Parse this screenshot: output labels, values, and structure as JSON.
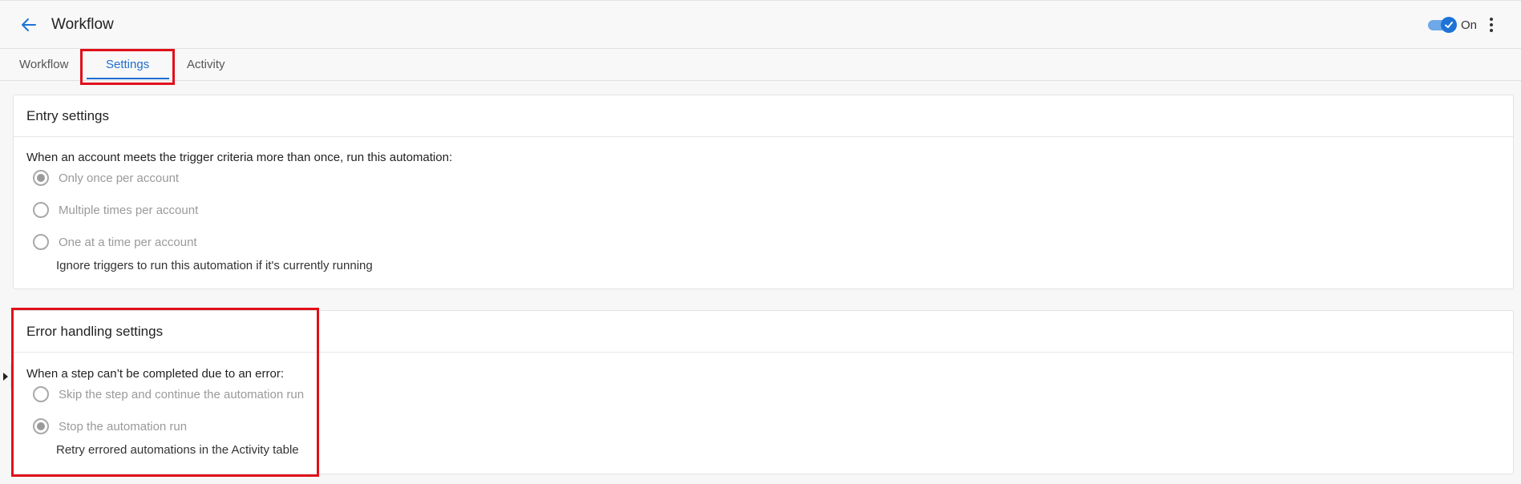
{
  "header": {
    "title": "Workflow",
    "toggle_state": "On",
    "back_icon": "arrow-left-icon",
    "more_icon": "more-vertical-icon",
    "accent_color": "#1e73d6"
  },
  "tabs": [
    {
      "label": "Workflow",
      "active": false
    },
    {
      "label": "Settings",
      "active": true
    },
    {
      "label": "Activity",
      "active": false
    }
  ],
  "entry_settings": {
    "title": "Entry settings",
    "question": "When an account meets the trigger criteria more than once, run this automation:",
    "options": [
      {
        "label": "Only once per account",
        "checked": true
      },
      {
        "label": "Multiple times per account",
        "checked": false
      },
      {
        "label": "One at a time per account",
        "checked": false
      }
    ],
    "helper": "Ignore triggers to run this automation if it's currently running"
  },
  "error_settings": {
    "title": "Error handling settings",
    "question": "When a step can’t be completed due to an error:",
    "options": [
      {
        "label": "Skip the step and continue the automation run",
        "checked": false
      },
      {
        "label": "Stop the automation run",
        "checked": true
      }
    ],
    "helper": "Retry errored automations in the Activity table"
  },
  "highlight_color": "#e0101a"
}
